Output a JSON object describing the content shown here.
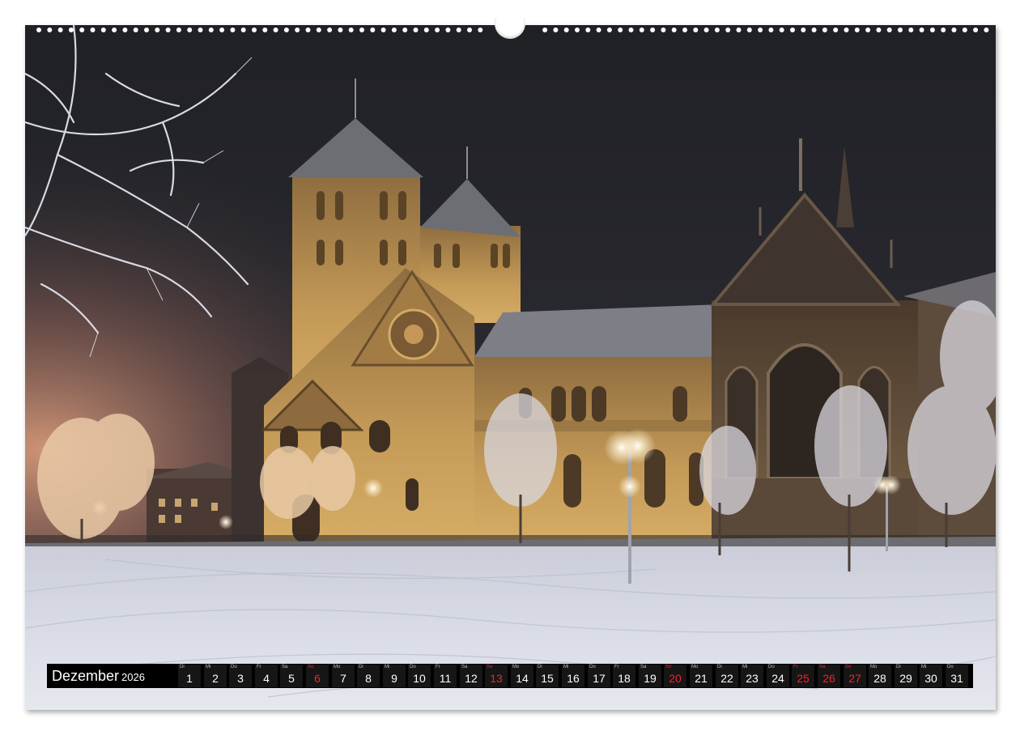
{
  "calendar": {
    "month": "Dezember",
    "year": "2026",
    "highlight_color": "#e8262d",
    "days": [
      {
        "n": "1",
        "dow": "Di",
        "red": false
      },
      {
        "n": "2",
        "dow": "Mi",
        "red": false
      },
      {
        "n": "3",
        "dow": "Do",
        "red": false
      },
      {
        "n": "4",
        "dow": "Fr",
        "red": false
      },
      {
        "n": "5",
        "dow": "Sa",
        "red": false
      },
      {
        "n": "6",
        "dow": "So",
        "red": true
      },
      {
        "n": "7",
        "dow": "Mo",
        "red": false
      },
      {
        "n": "8",
        "dow": "Di",
        "red": false
      },
      {
        "n": "9",
        "dow": "Mi",
        "red": false
      },
      {
        "n": "10",
        "dow": "Do",
        "red": false
      },
      {
        "n": "11",
        "dow": "Fr",
        "red": false
      },
      {
        "n": "12",
        "dow": "Sa",
        "red": false
      },
      {
        "n": "13",
        "dow": "So",
        "red": true
      },
      {
        "n": "14",
        "dow": "Mo",
        "red": false
      },
      {
        "n": "15",
        "dow": "Di",
        "red": false
      },
      {
        "n": "16",
        "dow": "Mi",
        "red": false
      },
      {
        "n": "17",
        "dow": "Do",
        "red": false
      },
      {
        "n": "18",
        "dow": "Fr",
        "red": false
      },
      {
        "n": "19",
        "dow": "Sa",
        "red": false
      },
      {
        "n": "20",
        "dow": "So",
        "red": true
      },
      {
        "n": "21",
        "dow": "Mo",
        "red": false
      },
      {
        "n": "22",
        "dow": "Di",
        "red": false
      },
      {
        "n": "23",
        "dow": "Mi",
        "red": false
      },
      {
        "n": "24",
        "dow": "Do",
        "red": false
      },
      {
        "n": "25",
        "dow": "Fr",
        "red": true
      },
      {
        "n": "26",
        "dow": "Sa",
        "red": true
      },
      {
        "n": "27",
        "dow": "So",
        "red": true
      },
      {
        "n": "28",
        "dow": "Mo",
        "red": false
      },
      {
        "n": "29",
        "dow": "Di",
        "red": false
      },
      {
        "n": "30",
        "dow": "Mi",
        "red": false
      },
      {
        "n": "31",
        "dow": "Do",
        "red": false
      }
    ]
  },
  "photo": {
    "subject": "cathedral-square-night-snow-illustration",
    "sky_color": "#24252b",
    "glow_color": "#c98a6a",
    "stone_color": "#b98f4e",
    "snow_color": "#d9dbe6"
  }
}
